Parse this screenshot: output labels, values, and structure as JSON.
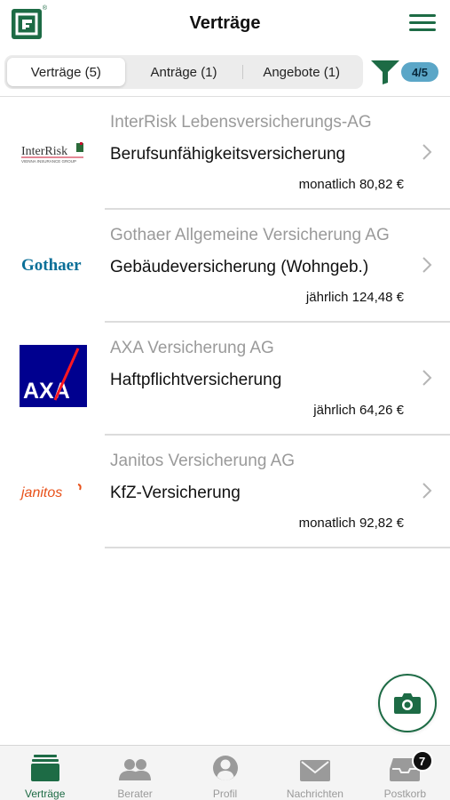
{
  "header": {
    "title": "Verträge",
    "logo_icon": "app-logo-icon",
    "menu_icon": "hamburger-menu-icon"
  },
  "tabs": [
    {
      "label": "Verträge (5)",
      "active": true
    },
    {
      "label": "Anträge (1)",
      "active": false
    },
    {
      "label": "Angebote (1)",
      "active": false
    }
  ],
  "filter": {
    "icon": "filter-funnel-icon",
    "badge": "4/5"
  },
  "contracts": [
    {
      "insurer": "InterRisk Lebensversicherungs-AG",
      "product": "Berufsunfähigkeitsversicherung",
      "premium": "monatlich 80,82 €",
      "logo_text": "InterRisk",
      "logo_subtext": "VIENNA INSURANCE GROUP"
    },
    {
      "insurer": "Gothaer Allgemeine Versicherung AG",
      "product": "Gebäudeversicherung (Wohngeb.)",
      "premium": "jährlich 124,48 €",
      "logo_text": "Gothaer"
    },
    {
      "insurer": "AXA Versicherung AG",
      "product": "Haftpflichtversicherung",
      "premium": "jährlich 64,26 €",
      "logo_text": "AXA"
    },
    {
      "insurer": "Janitos Versicherung AG",
      "product": "KfZ-Versicherung",
      "premium": "monatlich 92,82 €",
      "logo_text": "janitos"
    }
  ],
  "camera_icon": "camera-icon",
  "bottom_nav": [
    {
      "label": "Verträge",
      "icon": "folder-stack-icon",
      "active": true
    },
    {
      "label": "Berater",
      "icon": "advisor-people-icon",
      "active": false
    },
    {
      "label": "Profil",
      "icon": "profile-user-icon",
      "active": false
    },
    {
      "label": "Nachrichten",
      "icon": "envelope-icon",
      "active": false
    },
    {
      "label": "Postkorb",
      "icon": "inbox-tray-icon",
      "active": false,
      "badge": "7"
    }
  ],
  "colors": {
    "brand_green": "#1d6b45",
    "badge_blue": "#5ba6c7",
    "axa_blue": "#00008f",
    "axa_red": "#ff1721",
    "gothaer_blue": "#0a6f98",
    "janitos_orange": "#e8511a",
    "interisk_red": "#c8102e"
  }
}
